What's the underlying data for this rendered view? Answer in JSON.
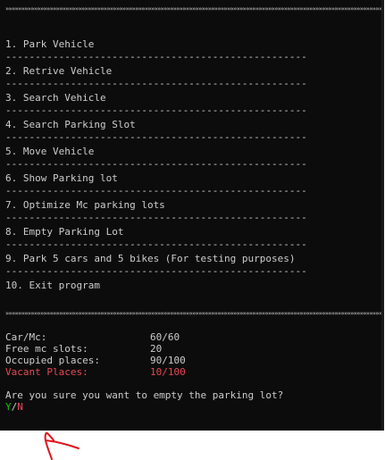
{
  "window": {
    "top_separator": "»»»»»»»»»»»»»»»»»»»»»»»»»»»»»»»»»»»»»»»»»»»»»»»»»»»»»»»»»»»»»»»»»»»»»»»»»»»»»»»»»»»»»»»»»»»»»»»»»»»»»»»»»»»»»»»»»»»»»»»»»»»»»»»»»»»»»»»»»»»»»»»»»»»»",
    "dash_line": "---------------------------------------------------"
  },
  "menu": {
    "items": [
      "1. Park Vehicle",
      "2. Retrive Vehicle",
      "3. Search Vehicle",
      "4. Search Parking Slot",
      "5. Move Vehicle",
      "6. Show Parking lot",
      "7. Optimize Mc parking lots",
      "8. Empty Parking Lot",
      "9. Park 5 cars and 5 bikes (For testing purposes)",
      "10. Exit program"
    ]
  },
  "mid_separator": "»»»»»»»»»»»»»»»»»»»»»»»»»»»»»»»»»»»»»»»»»»»»»»»»»»»»»»»»»»»»»»»»»»»»»»»»»»»»»»»»»»»»»»»»»»»»»»»»»»»»»»»»»»»»»»»»»»»»»»»»»»»»»»»»»»»»»»»»»»»»»»»»»»»»",
  "stats": [
    {
      "label": "Car/Mc:",
      "value": "60/60",
      "color": "#cccccc"
    },
    {
      "label": "Free mc slots:",
      "value": "20",
      "color": "#cccccc"
    },
    {
      "label": "Occupied places:",
      "value": "90/100",
      "color": "#cccccc"
    },
    {
      "label": "Vacant Places:",
      "value": "10/100",
      "color": "#e74856"
    }
  ],
  "prompt": {
    "question": "Are you sure you want to empty the parking lot?",
    "yes": "Y",
    "slash": "/",
    "no": "N"
  },
  "colors": {
    "background": "#0c0c0c",
    "text": "#cccccc",
    "accent_red": "#e74856",
    "accent_green": "#16c60c",
    "annotation_red": "#e0141e"
  }
}
